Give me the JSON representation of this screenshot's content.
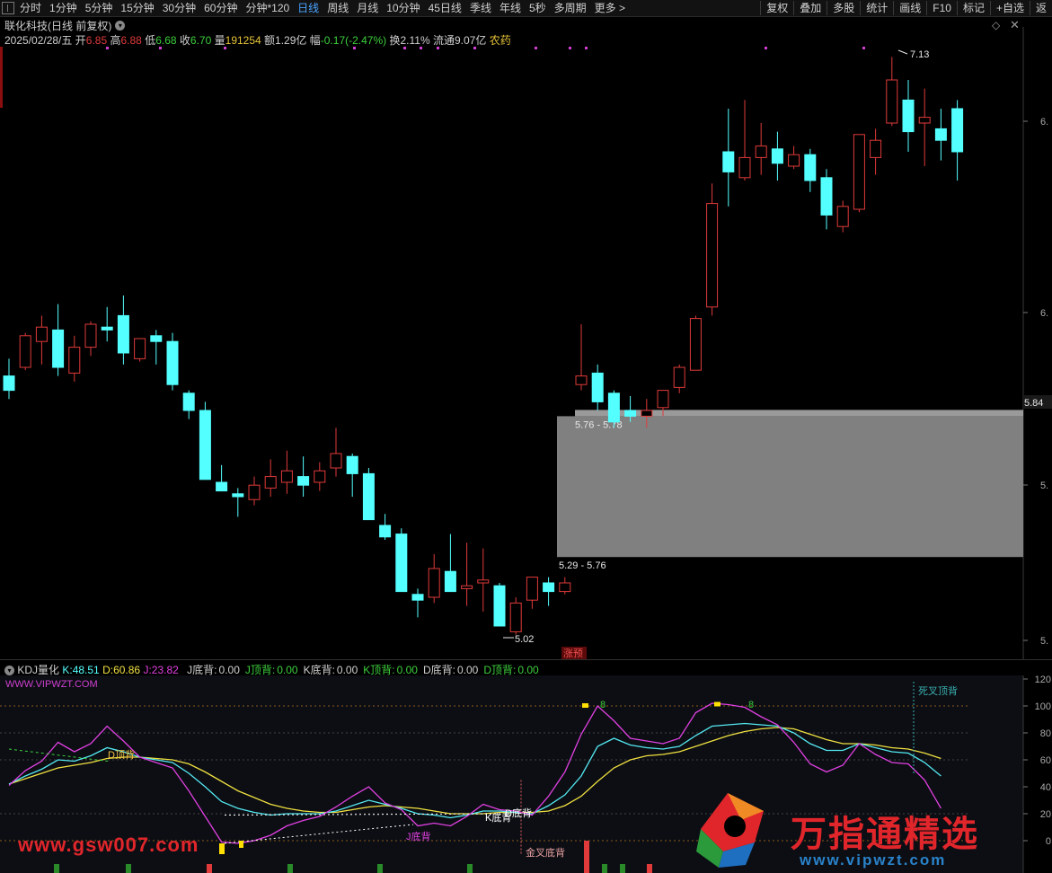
{
  "toolbar": {
    "timeframes": [
      "分时",
      "1分钟",
      "5分钟",
      "15分钟",
      "30分钟",
      "60分钟",
      "分钟*120",
      "日线",
      "周线",
      "月线",
      "10分钟",
      "45日线",
      "季线",
      "年线",
      "5秒",
      "多周期",
      "更多 >"
    ],
    "active_timeframe": "日线",
    "right_tools": [
      "复权",
      "叠加",
      "多股",
      "统计",
      "画线",
      "F10",
      "标记",
      "+自选",
      "返"
    ]
  },
  "header": {
    "stock_title": "联化科技(日线 前复权)",
    "date": "2025/02/28/五",
    "open_label": "开",
    "open": "6.85",
    "high_label": "高",
    "high": "6.88",
    "low_label": "低",
    "low": "6.68",
    "close_label": "收",
    "close": "6.70",
    "volume_label": "量",
    "volume": "191254",
    "amount_label": "额",
    "amount": "1.29亿",
    "change_label": "幅",
    "change": "-0.17(-2.47%)",
    "turnover_label": "换",
    "turnover": "2.11%",
    "float_label": "流通",
    "float": "9.07亿",
    "industry": "农药"
  },
  "price_chart": {
    "annotations": {
      "high_mark": "7.13",
      "low_mark": "5.02",
      "gap_upper": "5.76 - 5.78",
      "gap_lower": "5.29 - 5.76",
      "limit_badge": "涨预",
      "current_price": "5.84"
    },
    "axis_labels": [
      "6.",
      "6.",
      "5.",
      "5."
    ],
    "colors": {
      "up": "#e03a3a",
      "down": "#54ffff",
      "gap_box": "#808080"
    }
  },
  "indicator": {
    "name": "KDJ量化",
    "k_label": "K:",
    "k": "48.51",
    "d_label": "D:",
    "d": "60.86",
    "j_label": "J:",
    "j": "23.82",
    "flags": [
      {
        "label": "J底背:",
        "value": "0.00"
      },
      {
        "label": "J顶背:",
        "value": "0.00"
      },
      {
        "label": "K底背:",
        "value": "0.00"
      },
      {
        "label": "K顶背:",
        "value": "0.00"
      },
      {
        "label": "D底背:",
        "value": "0.00"
      },
      {
        "label": "D顶背:",
        "value": "0.00"
      }
    ],
    "site": "WWW.VIPWZT.COM",
    "axis_labels": [
      "120",
      "100",
      "80",
      "60",
      "40",
      "20",
      "0"
    ],
    "annotations": {
      "d_top_div": "D顶背",
      "j_bottom_div": "J底背",
      "k_bottom_div": "K底背",
      "d_bottom_div": "D底背",
      "golden_cross": "金叉底背",
      "death_cross": "死叉顶背",
      "marker_8a": "8",
      "marker_8b": "8"
    }
  },
  "watermarks": {
    "left": "www.gsw007.com",
    "right": "万指通精选",
    "url": "www.vipwzt.com"
  },
  "chart_data": {
    "type": "candlestick",
    "ohlc": [
      [
        5.92,
        5.98,
        5.84,
        5.87
      ],
      [
        5.95,
        6.07,
        5.94,
        6.06
      ],
      [
        6.04,
        6.13,
        5.96,
        6.09
      ],
      [
        6.08,
        6.17,
        5.92,
        5.95
      ],
      [
        5.93,
        6.06,
        5.9,
        6.02
      ],
      [
        6.02,
        6.11,
        5.99,
        6.1
      ],
      [
        6.09,
        6.16,
        6.04,
        6.08
      ],
      [
        6.13,
        6.2,
        5.96,
        6.0
      ],
      [
        5.98,
        6.04,
        5.97,
        6.05
      ],
      [
        6.06,
        6.08,
        5.96,
        6.04
      ],
      [
        6.04,
        6.07,
        5.87,
        5.89
      ],
      [
        5.86,
        5.87,
        5.77,
        5.8
      ],
      [
        5.8,
        5.83,
        5.58,
        5.56
      ],
      [
        5.55,
        5.61,
        5.52,
        5.52
      ],
      [
        5.51,
        5.53,
        5.43,
        5.5
      ],
      [
        5.49,
        5.57,
        5.47,
        5.54
      ],
      [
        5.53,
        5.63,
        5.5,
        5.57
      ],
      [
        5.55,
        5.66,
        5.51,
        5.59
      ],
      [
        5.57,
        5.64,
        5.5,
        5.54
      ],
      [
        5.55,
        5.62,
        5.52,
        5.59
      ],
      [
        5.6,
        5.74,
        5.57,
        5.65
      ],
      [
        5.64,
        5.65,
        5.5,
        5.58
      ],
      [
        5.58,
        5.6,
        5.43,
        5.42
      ],
      [
        5.4,
        5.44,
        5.35,
        5.36
      ],
      [
        5.37,
        5.39,
        5.2,
        5.17
      ],
      [
        5.16,
        5.18,
        5.08,
        5.14
      ],
      [
        5.15,
        5.3,
        5.13,
        5.25
      ],
      [
        5.24,
        5.37,
        5.2,
        5.17
      ],
      [
        5.18,
        5.34,
        5.12,
        5.19
      ],
      [
        5.2,
        5.32,
        5.1,
        5.21
      ],
      [
        5.19,
        5.2,
        5.06,
        5.05
      ],
      [
        5.03,
        5.15,
        5.02,
        5.13
      ],
      [
        5.14,
        5.21,
        5.11,
        5.22
      ],
      [
        5.2,
        5.22,
        5.12,
        5.17
      ],
      [
        5.17,
        5.22,
        5.16,
        5.2
      ],
      [
        5.89,
        6.1,
        5.87,
        5.92
      ],
      [
        5.93,
        5.96,
        5.8,
        5.83
      ],
      [
        5.86,
        5.87,
        5.74,
        5.76
      ],
      [
        5.8,
        5.85,
        5.76,
        5.78
      ],
      [
        5.78,
        5.84,
        5.74,
        5.8
      ],
      [
        5.81,
        5.87,
        5.78,
        5.87
      ],
      [
        5.88,
        5.96,
        5.86,
        5.95
      ],
      [
        5.94,
        6.13,
        5.94,
        6.12
      ],
      [
        6.16,
        6.59,
        6.13,
        6.52
      ],
      [
        6.7,
        6.85,
        6.51,
        6.63
      ],
      [
        6.61,
        6.88,
        6.6,
        6.68
      ],
      [
        6.68,
        6.8,
        6.62,
        6.72
      ],
      [
        6.71,
        6.77,
        6.6,
        6.66
      ],
      [
        6.65,
        6.72,
        6.64,
        6.69
      ],
      [
        6.69,
        6.71,
        6.56,
        6.6
      ],
      [
        6.61,
        6.64,
        6.43,
        6.48
      ],
      [
        6.44,
        6.53,
        6.42,
        6.51
      ],
      [
        6.5,
        6.75,
        6.49,
        6.76
      ],
      [
        6.68,
        6.78,
        6.62,
        6.74
      ],
      [
        6.8,
        7.03,
        6.79,
        6.95
      ],
      [
        6.88,
        6.95,
        6.7,
        6.77
      ],
      [
        6.8,
        6.92,
        6.65,
        6.82
      ],
      [
        6.78,
        6.85,
        6.67,
        6.74
      ],
      [
        6.85,
        6.88,
        6.6,
        6.7
      ]
    ],
    "kdj": {
      "K": [
        42,
        48,
        53,
        60,
        59,
        63,
        69,
        66,
        62,
        60,
        58,
        50,
        40,
        29,
        24,
        21,
        19,
        20,
        20,
        20,
        22,
        26,
        30,
        27,
        24,
        20,
        19,
        17,
        19,
        22,
        22,
        21,
        20,
        26,
        34,
        48,
        70,
        76,
        71,
        69,
        68,
        70,
        78,
        85,
        86,
        87,
        86,
        85,
        80,
        72,
        67,
        67,
        72,
        69,
        66,
        65,
        58,
        48
      ],
      "D": [
        42,
        46,
        50,
        54,
        56,
        58,
        61,
        62,
        62,
        61,
        60,
        57,
        51,
        44,
        37,
        32,
        27,
        24,
        22,
        21,
        21,
        23,
        25,
        26,
        25,
        24,
        22,
        20,
        20,
        20,
        21,
        21,
        21,
        22,
        26,
        33,
        44,
        54,
        60,
        63,
        64,
        66,
        70,
        74,
        78,
        81,
        83,
        84,
        83,
        79,
        75,
        72,
        72,
        71,
        69,
        68,
        65,
        61
      ],
      "J": [
        41,
        52,
        59,
        73,
        66,
        72,
        85,
        74,
        62,
        58,
        54,
        37,
        18,
        -1,
        -2,
        0,
        4,
        11,
        15,
        18,
        25,
        33,
        40,
        28,
        23,
        11,
        13,
        11,
        18,
        27,
        23,
        22,
        19,
        33,
        51,
        79,
        100,
        89,
        76,
        74,
        72,
        76,
        95,
        102,
        101,
        99,
        92,
        86,
        73,
        57,
        51,
        56,
        72,
        64,
        58,
        57,
        45,
        24
      ]
    }
  }
}
